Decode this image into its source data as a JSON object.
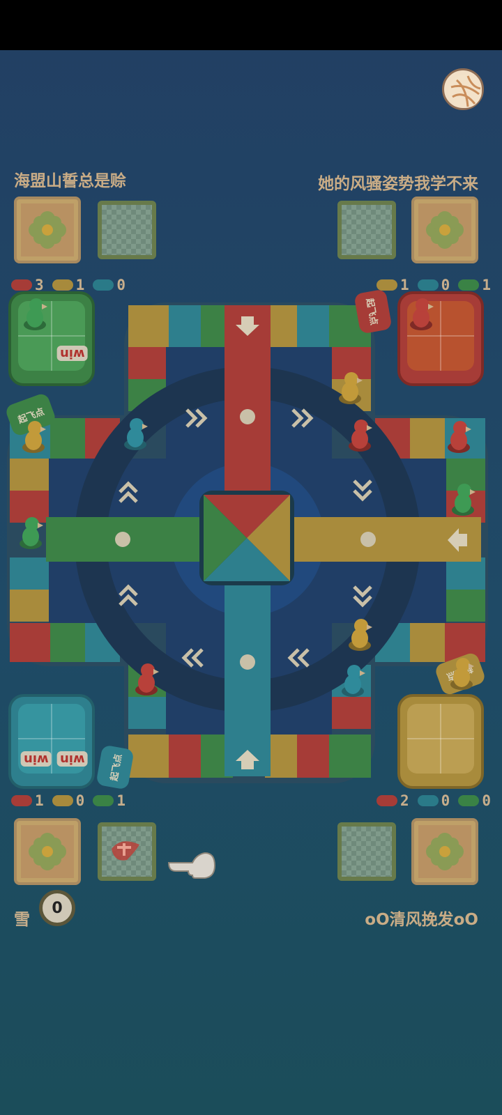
{
  "players": {
    "top_left": {
      "name": "海盟山誓总是赊",
      "counts": [
        3,
        1,
        0
      ]
    },
    "top_right": {
      "name": "她的风骚姿势我学不来",
      "counts": [
        1,
        0,
        1
      ]
    },
    "bottom_left": {
      "counts": [
        1,
        0,
        1
      ]
    },
    "bottom_right": {
      "name": "oO清风挽发oO",
      "counts": [
        2,
        0,
        0
      ]
    }
  },
  "self_player": {
    "name": "雪",
    "score": "0"
  },
  "hangars": {
    "win_label": "win"
  },
  "takeoff_label": "起飞点",
  "colors": {
    "red": "#b8413a",
    "yellow": "#c29a3a",
    "blue": "#2f8a9a",
    "green": "#3c8f4a"
  },
  "icons": [
    "menu-ball-icon",
    "flower-card-icon",
    "parrot-piece-icon",
    "pointing-hand-icon",
    "arrow-icon"
  ]
}
